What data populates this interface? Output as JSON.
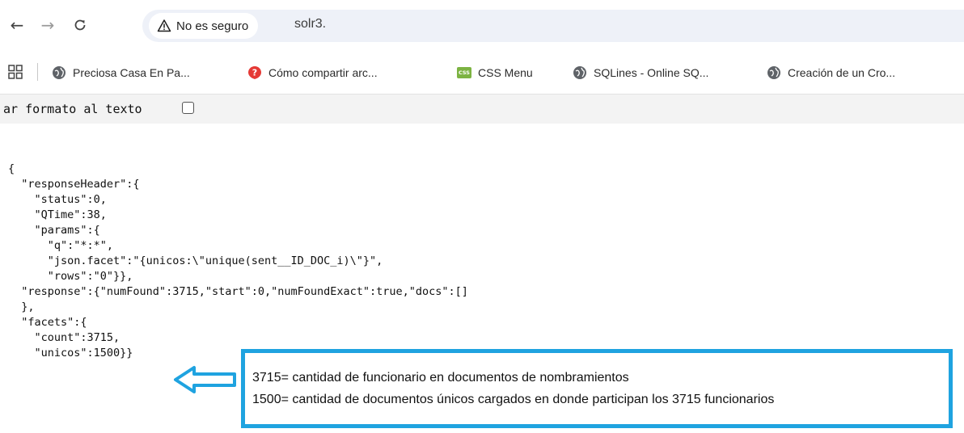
{
  "browser": {
    "security_label": "No es seguro",
    "url": "solr3.",
    "nav": {
      "back": "←",
      "forward": "→",
      "reload": "C"
    },
    "bookmarks": [
      {
        "label": "Preciosa Casa En Pa...",
        "icon": "globe-icon"
      },
      {
        "label": "Cómo compartir arc...",
        "icon": "question-icon"
      },
      {
        "label": "CSS Menu",
        "icon": "css-icon"
      },
      {
        "label": "SQLines - Online SQ...",
        "icon": "globe-icon"
      },
      {
        "label": "Creación de un Cro...",
        "icon": "globe-icon"
      }
    ]
  },
  "page": {
    "format_label": "ar formato al texto",
    "format_checked": false,
    "json_lines": [
      "{",
      "  \"responseHeader\":{",
      "    \"status\":0,",
      "    \"QTime\":38,",
      "    \"params\":{",
      "      \"q\":\"*:*\",",
      "      \"json.facet\":\"{unicos:\\\"unique(sent__ID_DOC_i)\\\"}\",",
      "      \"rows\":\"0\"}},",
      "  \"response\":{\"numFound\":3715,\"start\":0,\"numFoundExact\":true,\"docs\":[]",
      "  },",
      "  \"facets\":{",
      "    \"count\":3715,",
      "    \"unicos\":1500}}"
    ]
  },
  "annotation": {
    "line1": "3715= cantidad de funcionario en documentos de nombramientos",
    "line2": "1500= cantidad de documentos únicos cargados en donde participan los 3715 funcionarios",
    "color": "#1fa3e0"
  }
}
